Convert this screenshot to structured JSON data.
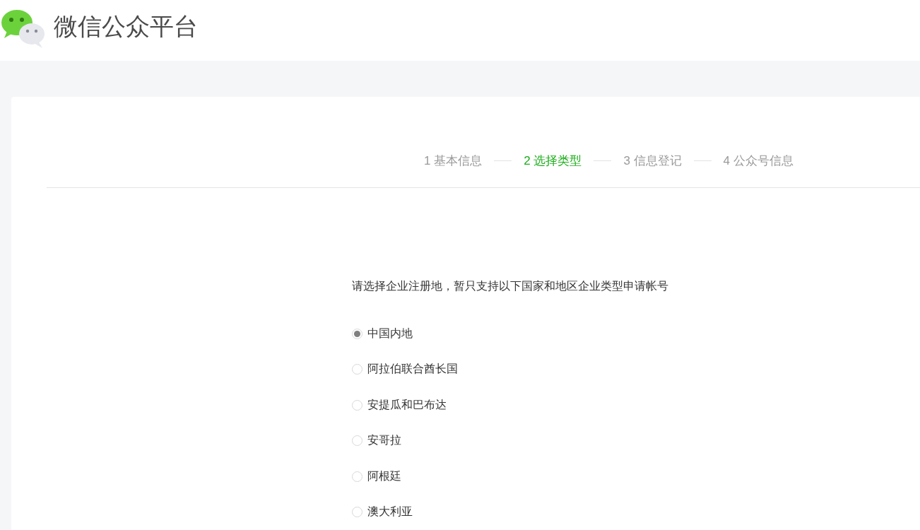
{
  "header": {
    "title": "微信公众平台"
  },
  "steps": [
    {
      "label": "1 基本信息",
      "selected": false
    },
    {
      "label": "2 选择类型",
      "selected": true
    },
    {
      "label": "3 信息登记",
      "selected": false
    },
    {
      "label": "4 公众号信息",
      "selected": false
    }
  ],
  "prompt": "请选择企业注册地，暂只支持以下国家和地区企业类型申请帐号",
  "regions": [
    {
      "label": "中国内地",
      "selected": true
    },
    {
      "label": "阿拉伯联合酋长国",
      "selected": false
    },
    {
      "label": "安提瓜和巴布达",
      "selected": false
    },
    {
      "label": "安哥拉",
      "selected": false
    },
    {
      "label": "阿根廷",
      "selected": false
    },
    {
      "label": "澳大利亚",
      "selected": false
    }
  ]
}
